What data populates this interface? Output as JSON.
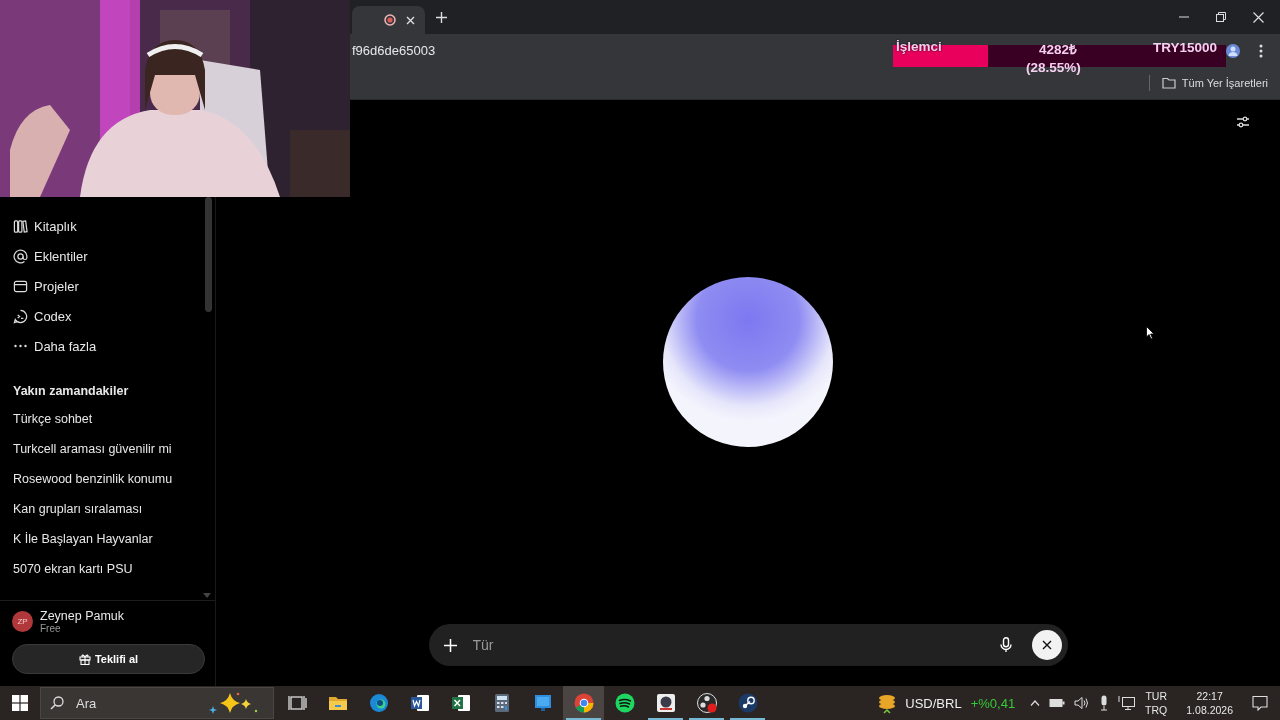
{
  "tab": {
    "recording": true
  },
  "address_bar": {
    "url": "f96d6de65003"
  },
  "bookmarks_bar": {
    "items": [
      {
        "label": "Tüm Yer İşaretleri"
      }
    ]
  },
  "cpu_widget": {
    "label": "İşlemci",
    "value": "4282₺",
    "percent": "(28.55%)",
    "target": "TRY15000",
    "level": 0.2855
  },
  "sidebar": {
    "nav": [
      {
        "label": "Kitaplık",
        "kind": "library"
      },
      {
        "label": "Eklentiler",
        "kind": "at"
      },
      {
        "label": "Projeler",
        "kind": "folder"
      },
      {
        "label": "Codex",
        "kind": "codex"
      },
      {
        "label": "Daha fazla",
        "kind": "more"
      }
    ],
    "section_title": "Yakın zamandakiler",
    "recent": [
      "Türkçe sohbet",
      "Turkcell araması güvenilir mi",
      "Rosewood benzinlik konumu",
      "Kan grupları sıralaması",
      "K İle Başlayan Hayvanlar",
      "5070 ekran kartı PSU"
    ],
    "user": {
      "initials": "ZP",
      "name": "Zeynep Pamuk",
      "plan": "Free"
    },
    "offer_button": "Teklifi al"
  },
  "composer": {
    "placeholder": "Tür"
  },
  "taskbar": {
    "search_placeholder": "Ara",
    "apps": [
      {
        "kind": "taskview",
        "selected": false,
        "running": false
      },
      {
        "kind": "explorer",
        "selected": false,
        "running": false
      },
      {
        "kind": "edge",
        "selected": false,
        "running": false
      },
      {
        "kind": "word",
        "selected": false,
        "running": false
      },
      {
        "kind": "excel",
        "selected": false,
        "running": false
      },
      {
        "kind": "calculator",
        "selected": false,
        "running": false
      },
      {
        "kind": "blueapp",
        "selected": false,
        "running": false
      },
      {
        "kind": "chrome",
        "selected": true,
        "running": true
      },
      {
        "kind": "spotify",
        "selected": false,
        "running": false
      },
      {
        "kind": "gameapp",
        "selected": false,
        "running": true
      },
      {
        "kind": "obs",
        "selected": false,
        "running": true
      },
      {
        "kind": "steam",
        "selected": false,
        "running": true
      }
    ],
    "ticker": {
      "pair": "USD/BRL",
      "change": "+%0,41"
    },
    "language": [
      "TUR",
      "TRQ"
    ],
    "time": "22:17",
    "date": "1.08.2026"
  }
}
